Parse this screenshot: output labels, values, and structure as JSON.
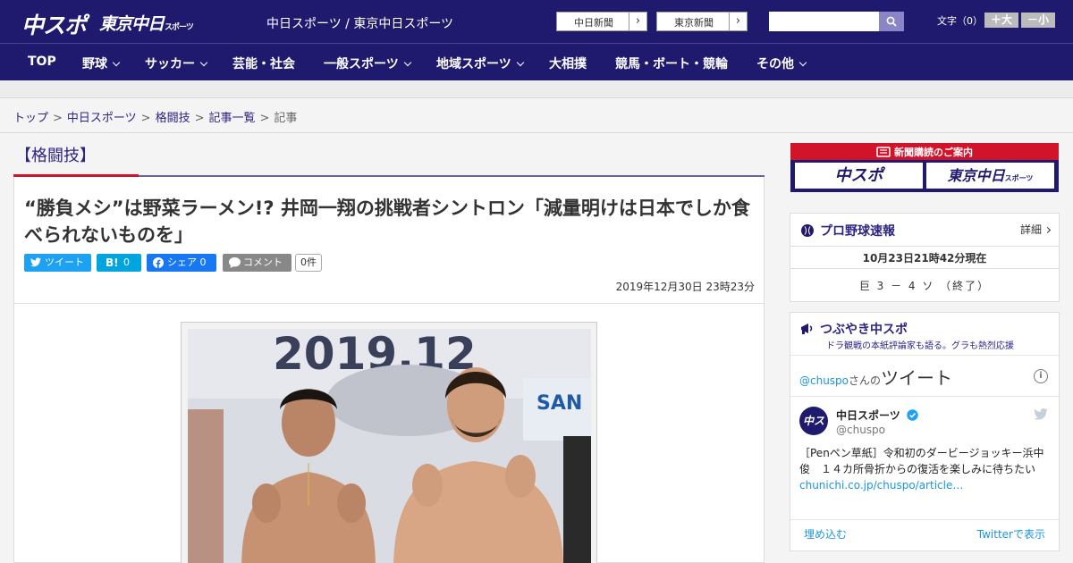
{
  "header": {
    "logo_chuspo": "中スポ",
    "logo_tokyo": "東京中日",
    "logo_tokyo_suffix": "スポーツ",
    "site_title": "中日スポーツ / 東京中日スポーツ",
    "ext_links": [
      "中日新聞",
      "東京新聞"
    ],
    "search": {
      "placeholder": "",
      "value": ""
    },
    "font_size_label": "文字（0）",
    "font_size_up": "＋大",
    "font_size_down": "－小"
  },
  "nav": {
    "items": [
      {
        "label": "TOP"
      },
      {
        "label": "野球"
      },
      {
        "label": "サッカー"
      },
      {
        "label": "芸能・社会"
      },
      {
        "label": "一般スポーツ"
      },
      {
        "label": "地域スポーツ"
      },
      {
        "label": "大相撲"
      },
      {
        "label": "競馬・ボート・競輪"
      },
      {
        "label": "その他"
      }
    ]
  },
  "breadcrumb": {
    "items": [
      "トップ",
      "中日スポーツ",
      "格闘技",
      "記事一覧",
      "記事"
    ],
    "separator": ">"
  },
  "article": {
    "category": "【格闘技】",
    "title": "“勝負メシ”は野菜ラーメン!? 井岡一翔の挑戦者シントロン「減量明けは日本でしか食べられないものを」",
    "share": {
      "twitter": "ツイート",
      "hatena_b": "B!",
      "hatena_count": "0",
      "facebook": "シェア 0",
      "comment": "コメント",
      "comment_count": "0件"
    },
    "date": "2019年12月30日 23時23分",
    "photo_alt": "2019.12"
  },
  "sidebar": {
    "promo": {
      "heading": "新聞購読のご案内",
      "btn_chuspo": "中スポ",
      "btn_tokyo": "東京中日",
      "btn_tokyo_suffix": "スポーツ"
    },
    "baseball": {
      "title": "プロ野球速報",
      "detail": "詳細",
      "time": "10月23日21時42分現在",
      "score": "巨 3 － 4 ソ （終了）"
    },
    "tweets": {
      "title": "つぶやき中スポ",
      "subtitle": "ドラ観戦の本紙評論家も語る。グラも熱烈応援",
      "handle": "@chuspo",
      "handle_suffix": "さんの",
      "heading": "ツイート",
      "info": "i",
      "avatar_text": "中ス",
      "account_name": "中日スポーツ",
      "account_user": "@chuspo",
      "tweet_text": "［Penペン草紙］令和初のダービージョッキー浜中俊　１４カ所骨折からの復活を楽しみに待ちたい",
      "tweet_link": "chunichi.co.jp/chuspo/article…",
      "embed_link": "埋め込む",
      "view_link": "Twitterで表示"
    }
  },
  "colors": {
    "navy": "#201a6e",
    "red": "#d0122a",
    "twitter": "#1da1f2",
    "hatena": "#00a4de",
    "facebook": "#1877f2"
  }
}
